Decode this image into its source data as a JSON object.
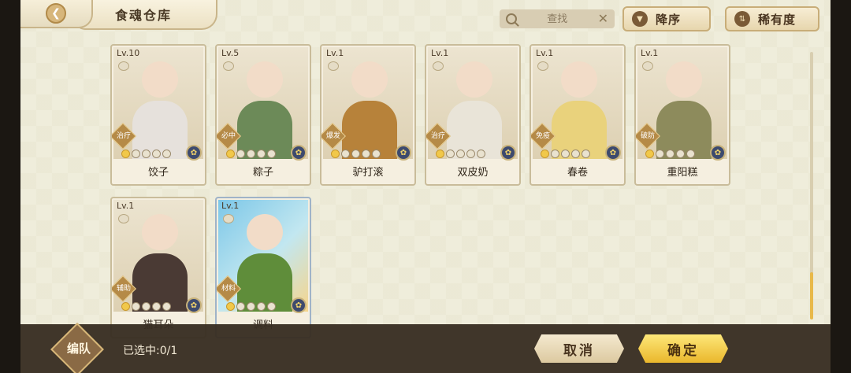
{
  "header": {
    "title": "食魂仓库",
    "search_placeholder": "查找",
    "sort_order_label": "降序",
    "sort_rarity_label": "稀有度"
  },
  "cards": [
    {
      "level": "Lv.10",
      "role": "治疗",
      "name": "饺子",
      "stars": 1,
      "body_color": "#e6e1dc",
      "selected": false
    },
    {
      "level": "Lv.5",
      "role": "必中",
      "name": "粽子",
      "stars": 1,
      "body_color": "#6c8a58",
      "selected": false
    },
    {
      "level": "Lv.1",
      "role": "爆发",
      "name": "驴打滚",
      "stars": 1,
      "body_color": "#b7823a",
      "selected": false
    },
    {
      "level": "Lv.1",
      "role": "治疗",
      "name": "双皮奶",
      "stars": 1,
      "body_color": "#e9e4d8",
      "selected": false
    },
    {
      "level": "Lv.1",
      "role": "免疫",
      "name": "春卷",
      "stars": 1,
      "body_color": "#e9d27c",
      "selected": false
    },
    {
      "level": "Lv.1",
      "role": "破防",
      "name": "重阳糕",
      "stars": 1,
      "body_color": "#8d8b5c",
      "selected": false
    },
    {
      "level": "Lv.1",
      "role": "辅助",
      "name": "猫耳朵",
      "stars": 1,
      "body_color": "#4a3a34",
      "selected": false
    },
    {
      "level": "Lv.1",
      "role": "材料",
      "name": "调料",
      "stars": 1,
      "body_color": "#5f8d3a",
      "selected": true
    }
  ],
  "bottom": {
    "edit_label": "编队",
    "selected_text": "已选中:0/1",
    "cancel_label": "取消",
    "confirm_label": "确定"
  }
}
